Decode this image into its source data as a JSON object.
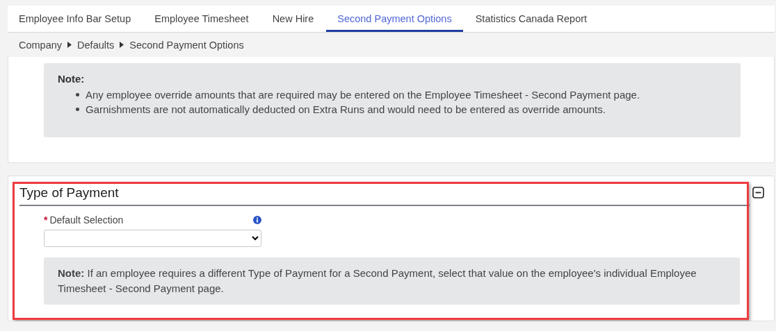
{
  "tabs": [
    {
      "label": "Employee Info Bar Setup",
      "selected": false
    },
    {
      "label": "Employee Timesheet",
      "selected": false
    },
    {
      "label": "New Hire",
      "selected": false
    },
    {
      "label": "Second Payment Options",
      "selected": true
    },
    {
      "label": "Statistics Canada Report",
      "selected": false
    }
  ],
  "breadcrumb": [
    "Company",
    "Defaults",
    "Second Payment Options"
  ],
  "note": {
    "title": "Note:",
    "items": [
      "Any employee override amounts that are required may be entered on the Employee Timesheet - Second Payment page.",
      "Garnishments are not automatically deducted on Extra Runs and would need to be entered as override amounts."
    ]
  },
  "type_of_payment": {
    "title": "Type of Payment",
    "expanded": true,
    "highlighted": true,
    "field": {
      "required_mark": "*",
      "label": "Default Selection"
    },
    "note": "**Note:** If an employee requires a different Type of Payment for a Second Payment, select that value on the employee's individual Employee Timesheet - Second Payment page."
  }
}
